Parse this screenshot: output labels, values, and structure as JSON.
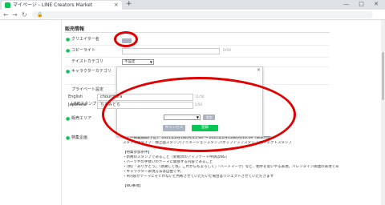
{
  "browser": {
    "tab_title": "マイページ - LINE Creators Market",
    "favicon": "LINE",
    "close_glyph": "×",
    "new_tab_glyph": "+",
    "window_controls": "— □ ✕",
    "back_glyph": "←",
    "forward_glyph": "→",
    "reload_glyph": "↻",
    "lock_glyph": "🔒"
  },
  "page": {
    "section_title": "販売情報",
    "rows": [
      {
        "label": "クリエイター名"
      },
      {
        "label": "コピーライト"
      },
      {
        "label": "テイストカテゴリ"
      },
      {
        "label": "キャラクターカテゴリ"
      },
      {
        "label": "プライベート設定"
      },
      {
        "label": "LINEスタンプ プレミアム"
      },
      {
        "label": "販売エリア"
      },
      {
        "label": "特集企画"
      }
    ],
    "taste_select": "不設定",
    "character_select": "不設定",
    "character_note": "当てはまるカテゴリが無い場合は、\"不設定\" を選択してください。",
    "copyright_count": "0/50",
    "bullet_glyph": "●"
  },
  "modal": {
    "close_glyph": "×",
    "languages": [
      {
        "label": "English",
        "value": "chourotora",
        "count": "11/50"
      },
      {
        "label": "Japanese",
        "value": "ちるみとら",
        "count": "5/50"
      }
    ],
    "add_label": "追加",
    "cancel_label": "キャンセル",
    "save_label": "登録"
  },
  "bottom": {
    "heading": "タイトル：長持ちを伝えるスタンプ特集",
    "lines": [
      "募集受付期間：2021年1月1日(木)11:00 ～ 2021年2月1日(月)10:59（日本時間）",
      "バナー掲載期間(予定)：2021年2月1日(月)11:00 ～ 2021年2月15日(月)10:59（日本時間）",
      "スタンプのタイプ：静止画スタンプ(アニメーションスタンプ/ポップアップスタンプ/エフェクトスタンプ",
      "",
      "【特集参加条件】",
      "・新規のスタンプであること（新規済のアップデート申請はNG）",
      "・パーツやの手拭いのテーマに関係する内容であること",
      "・（例）「ありがとう」「感謝してね」これからもよろしく」「ハートマーク」など、相手を思いやる表現。バレンタイン関連の表現であ",
      "・キャラクター表現方法は自由です。",
      "・※内容がテーマにそぐわないと判断させていただいた場合はリジェクトさせていただきます",
      "",
      "【NG事項】"
    ]
  }
}
